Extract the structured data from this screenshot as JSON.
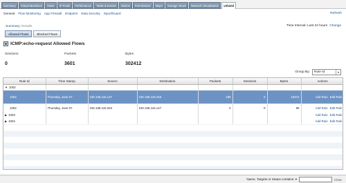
{
  "tabs": [
    "Summary",
    "Virtual Machines",
    "Hosts",
    "IP Pools",
    "Performance",
    "Tasks & Events",
    "Alarms",
    "Permissions",
    "Maps",
    "Storage Views",
    "Network Virtualization",
    "vShield"
  ],
  "subnav": [
    "General",
    "Flow Monitoring",
    "App Firewall",
    "Endpoint",
    "Data Security",
    "SpoofGuard"
  ],
  "refresh_label": "Refresh",
  "summary_link": "Summary",
  "details_link": "Details",
  "time_interval": "Time Interval: Last 24 hours",
  "change_label": "Change",
  "flow_buttons": {
    "allowed": "Allowed Flows",
    "blocked": "Blocked Flows"
  },
  "title": "ICMP:echo-request Allowed Flows",
  "stats": {
    "sessions_label": "Sessions",
    "sessions_value": "0",
    "packets_label": "Packets",
    "packets_value": "3601",
    "bytes_label": "Bytes",
    "bytes_value": "302412"
  },
  "group_by": {
    "label": "Group By:",
    "value": "Rule Id"
  },
  "table": {
    "headers": [
      "Rule Id",
      "Time Stamp",
      "Source",
      "Destination",
      "Packets",
      "Sessions",
      "Bytes",
      "Actions"
    ],
    "rows": [
      {
        "rule": "1002",
        "expanded": true
      },
      {
        "rule": "1002",
        "time": "Thursday, June 07",
        "src": "192.168.115.147",
        "dst": "192.168.115.255",
        "packets": "185",
        "sessions": "0",
        "bytes": "15372",
        "add": "Add Rule",
        "edit": "Edit Rule"
      },
      {
        "rule": "1002",
        "time": "Thursday, June 07",
        "src": "192.168.115.254",
        "dst": "192.168.115.147",
        "packets": "2",
        "sessions": "0",
        "bytes": "96",
        "add": "Add Rule",
        "edit": "Edit Rule"
      },
      {
        "rule": "1003",
        "add": "Add Rule",
        "edit": "Edit Rule"
      },
      {
        "rule": "1004",
        "add": "Add Rule",
        "edit": "Edit Rule"
      }
    ]
  },
  "status": {
    "filter_label": "Name, Targets or Status contains: ▾",
    "clear": "Clear"
  }
}
